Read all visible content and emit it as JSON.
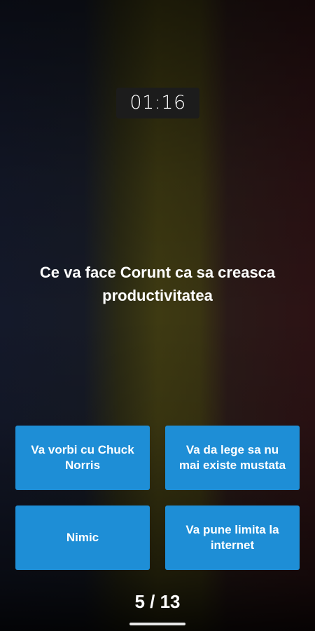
{
  "quiz": {
    "timer": "01:16",
    "question": "Ce va face Corunt ca sa creasca productivitatea",
    "answers": [
      {
        "label": "Va vorbi cu Chuck Norris"
      },
      {
        "label": "Va da lege sa nu mai existe mustata"
      },
      {
        "label": "Nimic"
      },
      {
        "label": "Va pune limita la internet"
      }
    ],
    "progress": "5 / 13"
  },
  "colors": {
    "answer_button": "#1e8ed6",
    "timer_background": "#1c1c1c",
    "background_bands": [
      "#161a26",
      "#3e3a12",
      "#2c1214"
    ]
  }
}
